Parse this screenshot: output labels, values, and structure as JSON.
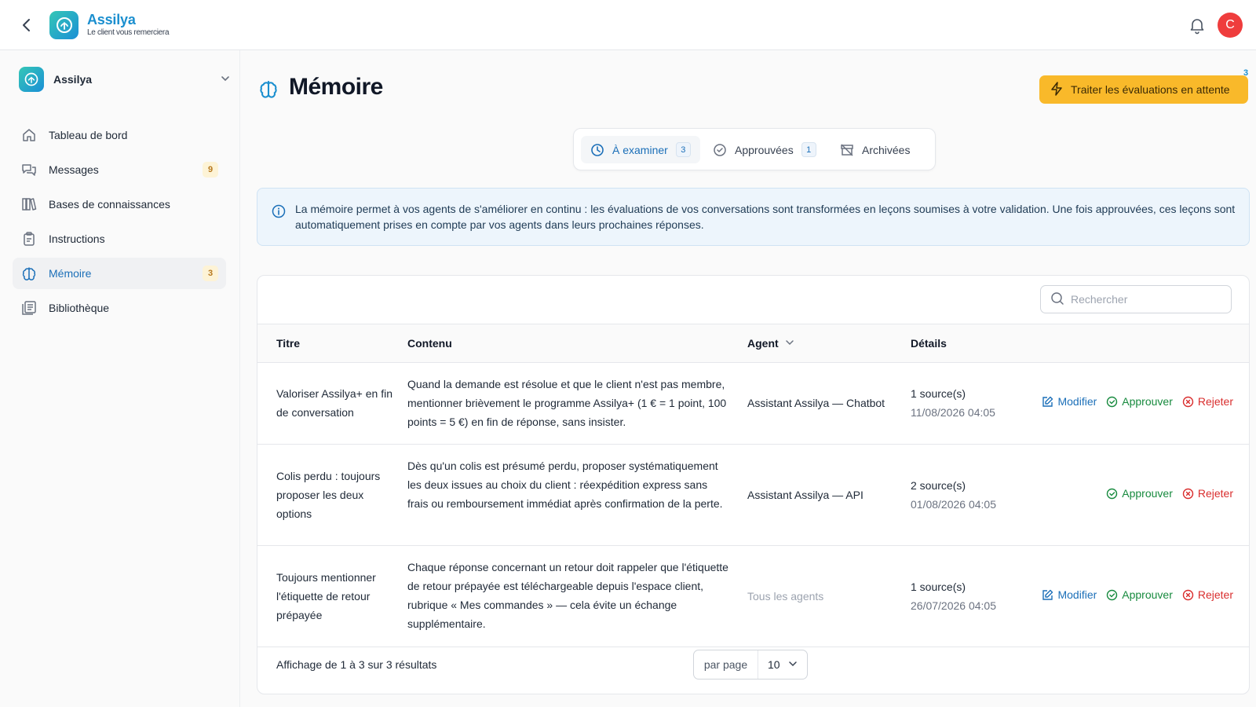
{
  "app": {
    "name": "Assilya",
    "tagline": "Le client vous remerciera",
    "user_initial": "C"
  },
  "sidebar": {
    "workspace": "Assilya",
    "items": [
      {
        "label": "Tableau de bord",
        "icon": "home-icon",
        "badge": ""
      },
      {
        "label": "Messages",
        "icon": "messages-icon",
        "badge": "9"
      },
      {
        "label": "Bases de connaissances",
        "icon": "books-icon",
        "badge": ""
      },
      {
        "label": "Instructions",
        "icon": "clipboard-icon",
        "badge": ""
      },
      {
        "label": "Mémoire",
        "icon": "brain-icon",
        "badge": "3"
      },
      {
        "label": "Bibliothèque",
        "icon": "library-icon",
        "badge": ""
      }
    ]
  },
  "page": {
    "title": "Mémoire",
    "cta_label": "Traiter les évaluations en attente",
    "cta_count": "3"
  },
  "tabs": [
    {
      "label": "À examiner",
      "count": "3"
    },
    {
      "label": "Approuvées",
      "count": "1"
    },
    {
      "label": "Archivées",
      "count": ""
    }
  ],
  "info": {
    "text": "La mémoire permet à vos agents de s'améliorer en continu : les évaluations de vos conversations sont transformées en leçons soumises à votre validation. Une fois approuvées, ces leçons sont automatiquement prises en compte par vos agents dans leurs prochaines réponses."
  },
  "search": {
    "placeholder": "Rechercher"
  },
  "table": {
    "columns": {
      "title": "Titre",
      "content": "Contenu",
      "agent": "Agent",
      "details": "Détails"
    },
    "actions": {
      "edit": "Modifier",
      "approve": "Approuver",
      "reject": "Rejeter"
    },
    "rows": [
      {
        "title": "Valoriser Assilya+ en fin de conversation",
        "content": "Quand la demande est résolue et que le client n'est pas membre, mentionner brièvement le programme Assilya+ (1 € = 1 point, 100 points = 5 €) en fin de réponse, sans insister.",
        "agent": "Assistant Assilya — Chatbot",
        "sources": "1 source(s)",
        "date": "11/08/2026 04:05"
      },
      {
        "title": "Colis perdu : toujours proposer les deux options",
        "content": "Dès qu'un colis est présumé perdu, proposer systématiquement les deux issues au choix du client : réexpédition express sans frais ou remboursement immédiat après confirmation de la perte.",
        "agent": "Assistant Assilya — API",
        "sources": "2 source(s)",
        "date": "01/08/2026 04:05"
      },
      {
        "title": "Toujours mentionner l'étiquette de retour prépayée",
        "content": "Chaque réponse concernant un retour doit rappeler que l'étiquette de retour prépayée est téléchargeable depuis l'espace client, rubrique « Mes commandes » — cela évite un échange supplémentaire.",
        "agent": "Tous les agents",
        "sources": "1 source(s)",
        "date": "26/07/2026 04:05"
      }
    ]
  },
  "pagination": {
    "summary": "Affichage de 1 à 3 sur 3 résultats",
    "per_page_label": "par page",
    "per_page_value": "10"
  },
  "colors": {
    "brand": "#1b8fcf",
    "accent": "#f9b92a",
    "approve": "#178a3e",
    "reject": "#d92d2d"
  }
}
